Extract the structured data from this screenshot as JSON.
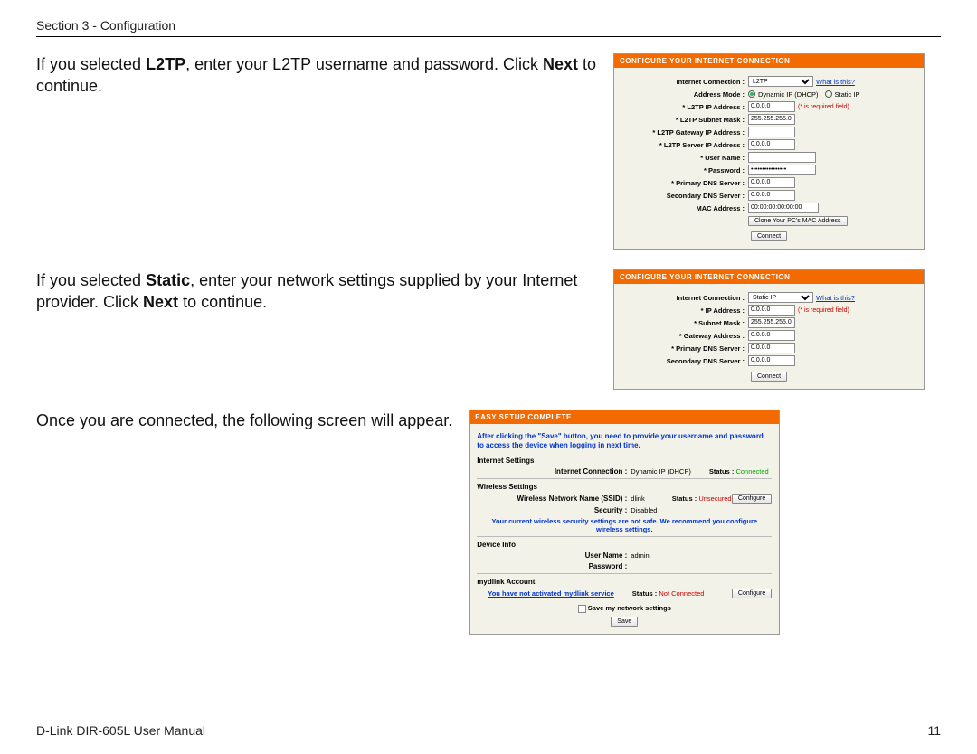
{
  "header": {
    "section": "Section 3 - Configuration"
  },
  "footer": {
    "manual": "D-Link DIR-605L User Manual",
    "page": "11"
  },
  "instr1": {
    "prefix": "If you selected ",
    "bold1": "L2TP",
    "mid": ", enter your L2TP username and password. Click ",
    "bold2": "Next",
    "suffix": " to continue."
  },
  "instr2": {
    "prefix": "If you selected ",
    "bold1": "Static",
    "mid": ", enter your network settings supplied by your Internet provider. Click ",
    "bold2": "Next",
    "suffix": " to continue."
  },
  "instr3": {
    "text": "Once you are connected, the following screen will appear."
  },
  "panel1": {
    "title": "CONFIGURE YOUR INTERNET CONNECTION",
    "labels": {
      "internet_connection": "Internet Connection :",
      "address_mode": "Address Mode :",
      "l2tp_ip": "* L2TP IP Address :",
      "l2tp_subnet": "* L2TP Subnet Mask :",
      "l2tp_gateway": "* L2TP Gateway IP Address :",
      "l2tp_server": "* L2TP Server IP Address :",
      "user_name": "* User Name :",
      "password": "* Password :",
      "primary_dns": "* Primary DNS Server :",
      "secondary_dns": "Secondary DNS Server :",
      "mac": "MAC Address :"
    },
    "values": {
      "internet_connection": "L2TP",
      "what_is_this": "What is this?",
      "dynamic": "Dynamic IP (DHCP)",
      "static": "Static IP",
      "l2tp_ip": "0.0.0.0",
      "required_note": "(* is required field)",
      "l2tp_subnet": "255.255.255.0",
      "l2tp_gateway": "",
      "l2tp_server": "0.0.0.0",
      "user_name": "",
      "password": "••••••••••••••••",
      "primary_dns": "0.0.0.0",
      "secondary_dns": "0.0.0.0",
      "mac": "00:00:00:00:00:00",
      "clone_btn": "Clone Your PC's MAC Address",
      "connect_btn": "Connect"
    }
  },
  "panel2": {
    "title": "CONFIGURE YOUR INTERNET CONNECTION",
    "labels": {
      "internet_connection": "Internet Connection :",
      "ip": "* IP Address :",
      "subnet": "* Subnet Mask :",
      "gateway": "* Gateway Address :",
      "primary_dns": "* Primary DNS Server :",
      "secondary_dns": "Secondary DNS Server :"
    },
    "values": {
      "internet_connection": "Static IP",
      "what_is_this": "What is this?",
      "ip": "0.0.0.0",
      "required_note": "(* is required field)",
      "subnet": "255.255.255.0",
      "gateway": "0.0.0.0",
      "primary_dns": "0.0.0.0",
      "secondary_dns": "0.0.0.0",
      "connect_btn": "Connect"
    }
  },
  "panel3": {
    "title": "EASY SETUP COMPLETE",
    "note": "After clicking the \"Save\" button, you need to provide your username and password to access the device when logging in next time.",
    "sections": {
      "internet": "Internet Settings",
      "wireless": "Wireless Settings",
      "device": "Device Info",
      "mydlink": "mydlink Account"
    },
    "internet": {
      "conn_label": "Internet Connection :",
      "conn_value": "Dynamic IP (DHCP)",
      "status_label": "Status :",
      "status_value": "Connected"
    },
    "wireless": {
      "ssid_label": "Wireless Network Name (SSID) :",
      "ssid_value": "dlink",
      "status_label": "Status :",
      "status_value": "Unsecured",
      "security_label": "Security :",
      "security_value": "Disabled",
      "warn": "Your current wireless security settings are not safe. We recommend you configure wireless settings.",
      "configure": "Configure"
    },
    "device": {
      "user_label": "User Name :",
      "user_value": "admin",
      "pass_label": "Password :",
      "pass_value": ""
    },
    "mydlink": {
      "msg": "You have not activated mydlink service",
      "status_label": "Status :",
      "status_value": "Not Connected",
      "configure": "Configure"
    },
    "save_settings": "Save my network settings",
    "save_btn": "Save"
  }
}
